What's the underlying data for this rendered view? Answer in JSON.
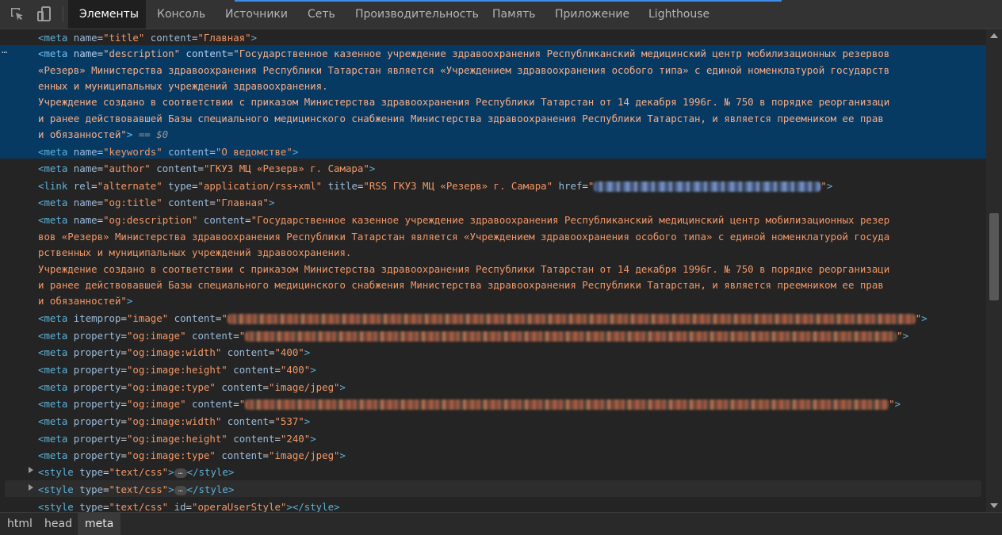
{
  "toolbar": {
    "tabs": [
      {
        "label": "Элементы",
        "active": true
      },
      {
        "label": "Консоль"
      },
      {
        "label": "Источники"
      },
      {
        "label": "Сеть"
      },
      {
        "label": "Производительность"
      },
      {
        "label": "Память"
      },
      {
        "label": "Приложение"
      },
      {
        "label": "Lighthouse"
      }
    ],
    "icons": [
      "inspect-element-icon",
      "device-toolbar-icon"
    ]
  },
  "code": {
    "l1": {
      "tag": "<meta",
      "a1": "name",
      "v1": "\"title\"",
      "a2": "content",
      "v2": "\"Главная\"",
      "end": ">"
    },
    "l2": {
      "tag": "<meta",
      "a1": "name",
      "v1": "\"description\"",
      "a2": "content",
      "p1": "\"Государственное казенное учреждение здравоохранения Республиканский медицинский центр мобилизационных резервов",
      "p2": "«Резерв» Министерства здравоохранения Республики Татарстан является «Учреждением здравоохранения особого типа» с единой номенклатурой государств",
      "p3": "енных и муниципальных учреждений здравоохранения.",
      "p4": "Учреждение создано в соответствии с приказом Министерства здравоохранения Республики Татарстан от 14 декабря 1996г. № 750 в порядке реорганизаци",
      "p5": "и ранее действовавшей Базы специального медицинского снабжения Министерства здравоохранения Республики Татарстан, и является преемником ее прав",
      "p6": "и обязанностей\"",
      "end": ">",
      "selected": " == $0"
    },
    "l3": {
      "tag": "<meta",
      "a1": "name",
      "v1": "\"keywords\"",
      "a2": "content",
      "v2": "\"О ведомстве\"",
      "end": ">"
    },
    "l4": {
      "tag": "<meta",
      "a1": "name",
      "v1": "\"author\"",
      "a2": "content",
      "v2": "\"ГКУЗ МЦ «Резерв» г. Самара\"",
      "end": ">"
    },
    "l5": {
      "tag": "<link",
      "a1": "rel",
      "v1": "\"alternate\"",
      "a2": "type",
      "v2": "\"application/rss+xml\"",
      "a3": "title",
      "v3": "\"RSS ГКУЗ МЦ «Резерв» г. Самара\"",
      "a4": "href",
      "q": "\"",
      "end": ">"
    },
    "l6": {
      "tag": "<meta",
      "a1": "name",
      "v1": "\"og:title\"",
      "a2": "content",
      "v2": "\"Главная\"",
      "end": ">"
    },
    "l7": {
      "tag": "<meta",
      "a1": "name",
      "v1": "\"og:description\"",
      "a2": "content",
      "p1": "\"Государственное казенное учреждение здравоохранения Республиканский медицинский центр мобилизационных резер",
      "p2": "вов «Резерв» Министерства здравоохранения Республики Татарстан является «Учреждением здравоохранения особого типа» с единой номенклатурой госуда",
      "p3": "рственных и муниципальных учреждений здравоохранения.",
      "p4": "Учреждение создано в соответствии с приказом Министерства здравоохранения Республики Татарстан от 14 декабря 1996г. № 750 в порядке реорганизаци",
      "p5": "и ранее действовавшей Базы специального медицинского снабжения Министерства здравоохранения Республики Татарстан, и является преемником ее прав",
      "p6": "и обязанностей\"",
      "end": ">"
    },
    "l8": {
      "tag": "<meta",
      "a1": "itemprop",
      "v1": "\"image\"",
      "a2": "content",
      "q": "\"",
      "end": ">"
    },
    "l9": {
      "tag": "<meta",
      "a1": "property",
      "v1": "\"og:image\"",
      "a2": "content",
      "q": "\"",
      "end": ">"
    },
    "l10": {
      "tag": "<meta",
      "a1": "property",
      "v1": "\"og:image:width\"",
      "a2": "content",
      "v2": "\"400\"",
      "end": ">"
    },
    "l11": {
      "tag": "<meta",
      "a1": "property",
      "v1": "\"og:image:height\"",
      "a2": "content",
      "v2": "\"400\"",
      "end": ">"
    },
    "l12": {
      "tag": "<meta",
      "a1": "property",
      "v1": "\"og:image:type\"",
      "a2": "content",
      "v2": "\"image/jpeg\"",
      "end": ">"
    },
    "l13": {
      "tag": "<meta",
      "a1": "property",
      "v1": "\"og:image\"",
      "a2": "content",
      "q": "\"",
      "end": ">"
    },
    "l14": {
      "tag": "<meta",
      "a1": "property",
      "v1": "\"og:image:width\"",
      "a2": "content",
      "v2": "\"537\"",
      "end": ">"
    },
    "l15": {
      "tag": "<meta",
      "a1": "property",
      "v1": "\"og:image:height\"",
      "a2": "content",
      "v2": "\"240\"",
      "end": ">"
    },
    "l16": {
      "tag": "<meta",
      "a1": "property",
      "v1": "\"og:image:type\"",
      "a2": "content",
      "v2": "\"image/jpeg\"",
      "end": ">"
    },
    "l17": {
      "tag": "<style",
      "a1": "type",
      "v1": "\"text/css\"",
      "end": ">",
      "ellipsis": "…",
      "close": "</style>"
    },
    "l18": {
      "tag": "<style",
      "a1": "type",
      "v1": "\"text/css\"",
      "end": ">",
      "ellipsis": "…",
      "close": "</style>"
    },
    "l19": {
      "tag": "<style",
      "a1": "type",
      "v1": "\"text/css\"",
      "a2": "id",
      "v2": "\"operaUserStyle\"",
      "end": "></style>"
    },
    "gutter_dots": "…"
  },
  "breadcrumbs": [
    "html",
    "head",
    "meta"
  ],
  "colors": {
    "tag": "#5db0d7",
    "attr_name": "#9bbbdc",
    "attr_value": "#f29766",
    "selection": "#073a63",
    "accent": "#3d8ee8"
  }
}
